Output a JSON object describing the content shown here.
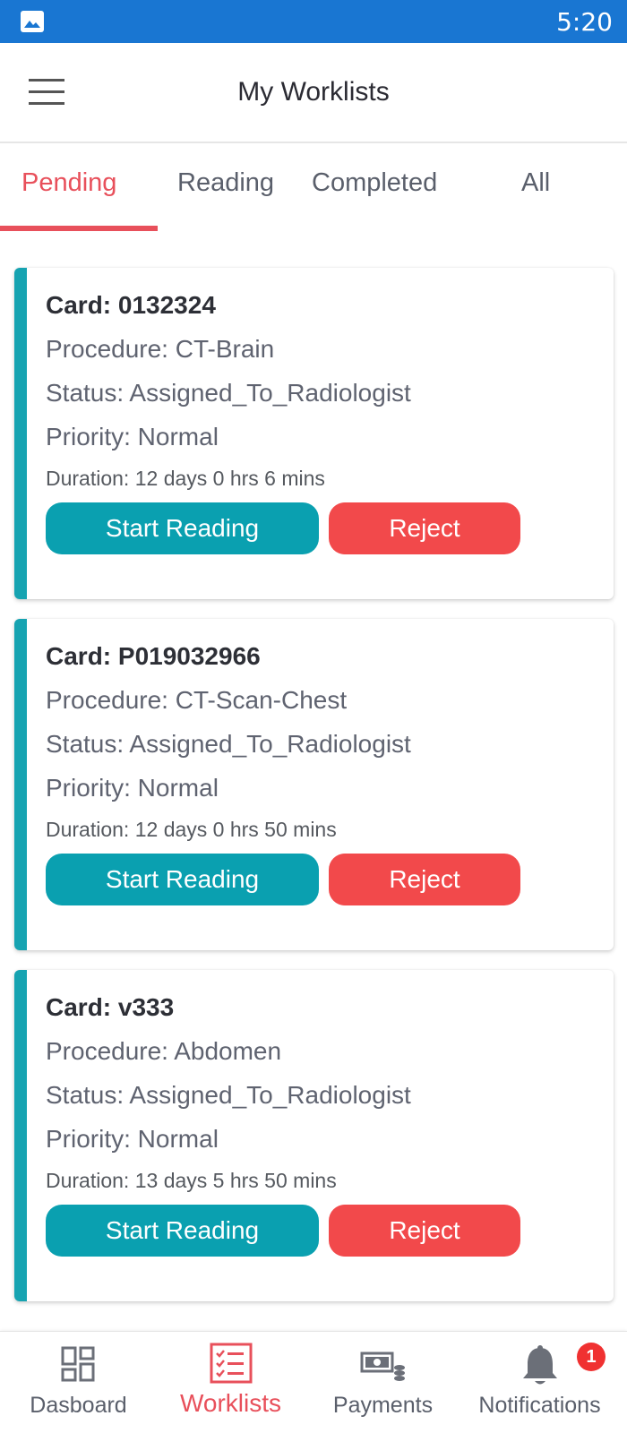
{
  "status_bar": {
    "time": "5:20",
    "left_icon": "image-icon"
  },
  "header": {
    "title": "My Worklists",
    "menu_icon": "hamburger-menu-icon"
  },
  "tabs": [
    {
      "label": "Pending",
      "active": true
    },
    {
      "label": "Reading",
      "active": false
    },
    {
      "label": "Completed",
      "active": false
    },
    {
      "label": "All",
      "active": false
    }
  ],
  "cards": [
    {
      "card_id": "Card: 0132324",
      "procedure": "Procedure: CT-Brain",
      "status": "Status: Assigned_To_Radiologist",
      "priority": "Priority: Normal",
      "duration": "Duration: 12 days 0 hrs 6 mins",
      "start_label": "Start Reading",
      "reject_label": "Reject"
    },
    {
      "card_id": "Card: P019032966",
      "procedure": "Procedure: CT-Scan-Chest",
      "status": "Status: Assigned_To_Radiologist",
      "priority": "Priority: Normal",
      "duration": "Duration: 12 days 0 hrs 50 mins",
      "start_label": "Start Reading",
      "reject_label": "Reject"
    },
    {
      "card_id": "Card: v333",
      "procedure": "Procedure: Abdomen",
      "status": "Status: Assigned_To_Radiologist",
      "priority": "Priority: Normal",
      "duration": "Duration: 13 days 5 hrs 50 mins",
      "start_label": "Start Reading",
      "reject_label": "Reject"
    }
  ],
  "bottom_nav": [
    {
      "label": "Dasboard",
      "icon": "dashboard-icon",
      "active": false
    },
    {
      "label": "Worklists",
      "icon": "checklist-icon",
      "active": true
    },
    {
      "label": "Payments",
      "icon": "payments-icon",
      "active": false
    },
    {
      "label": "Notifications",
      "icon": "bell-icon",
      "active": false,
      "badge": "1"
    }
  ],
  "colors": {
    "status_bar": "#1976d2",
    "accent_active": "#e8505b",
    "card_accent": "#16a3b1",
    "start_button": "#0aa0b0",
    "reject_button": "#f2494b",
    "badge": "#f03131"
  }
}
